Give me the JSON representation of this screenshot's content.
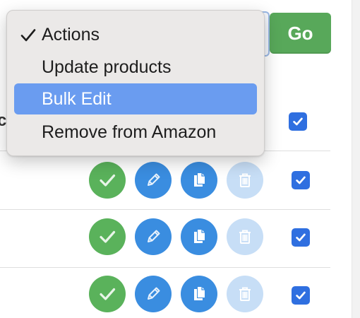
{
  "toolbar": {
    "go_label": "Go",
    "action_select": {
      "selected": "Actions",
      "options": [
        {
          "label": "Actions",
          "checked": true,
          "highlighted": false
        },
        {
          "label": "Update products",
          "checked": false,
          "highlighted": false
        },
        {
          "label": "Bulk Edit",
          "checked": false,
          "highlighted": true
        },
        {
          "label": "Remove from Amazon",
          "checked": false,
          "highlighted": false
        }
      ]
    }
  },
  "table": {
    "header_text_fragment": "c",
    "select_all_checked": true,
    "rows": [
      {
        "selected": true,
        "actions": [
          "approve-icon",
          "edit-icon",
          "copy-icon",
          "delete-icon"
        ]
      },
      {
        "selected": true,
        "actions": [
          "approve-icon",
          "edit-icon",
          "copy-icon",
          "delete-icon"
        ]
      },
      {
        "selected": true,
        "actions": [
          "approve-icon",
          "edit-icon",
          "copy-icon",
          "delete-icon"
        ]
      }
    ]
  },
  "colors": {
    "go_button": "#58a85a",
    "checkbox": "#2f6fe0",
    "approve_icon_bg": "#5ab25b",
    "edit_icon_bg": "#3a8de0",
    "delete_icon_bg_disabled": "#c7def6",
    "menu_highlight": "#6a9cf0",
    "menu_bg": "#ebe9e8"
  }
}
